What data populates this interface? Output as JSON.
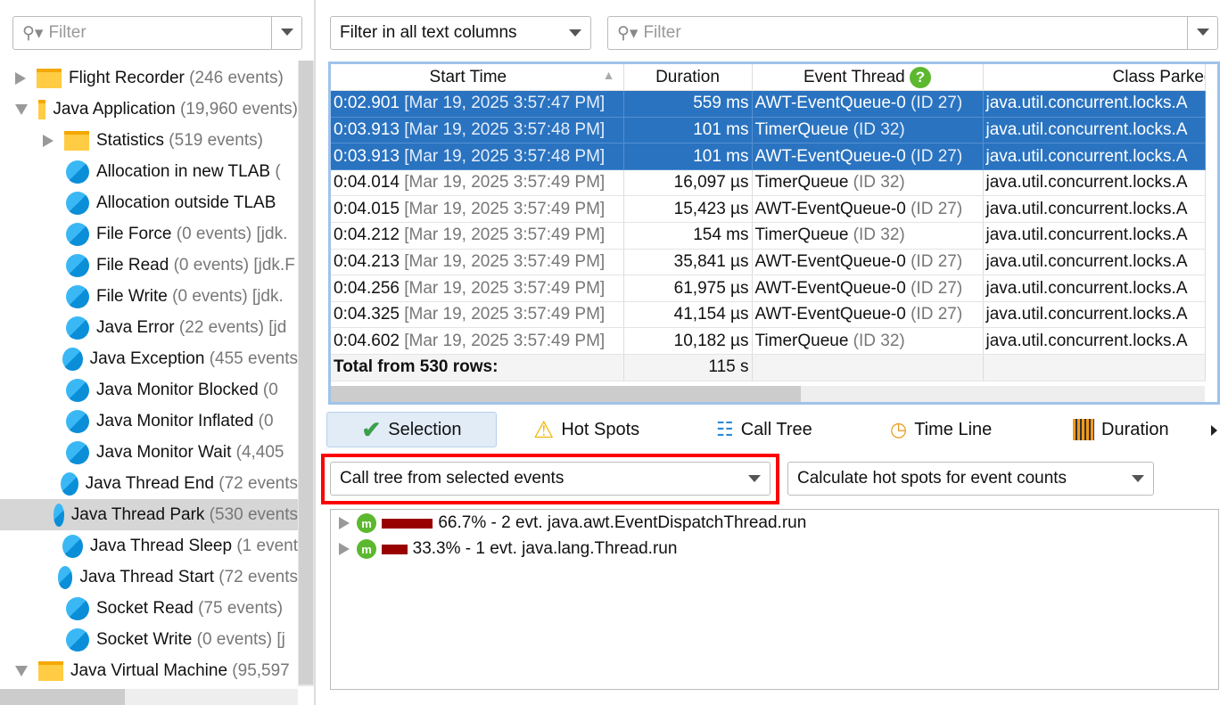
{
  "sidebar": {
    "filter_placeholder": "Filter",
    "items": [
      {
        "label": "Flight Recorder",
        "extra": " (246 events)",
        "type": "folder",
        "state": "collapsed",
        "indent": 0
      },
      {
        "label": "Java Application",
        "extra": " (19,960 events)",
        "type": "folder",
        "state": "expanded",
        "indent": 0
      },
      {
        "label": "Statistics",
        "extra": " (519 events)",
        "type": "folder",
        "state": "collapsed",
        "indent": 1
      },
      {
        "label": "Allocation in new TLAB",
        "extra": " (",
        "type": "event",
        "indent": 1
      },
      {
        "label": "Allocation outside TLAB",
        "extra": "",
        "type": "event",
        "indent": 1
      },
      {
        "label": "File Force",
        "extra": " (0 events) [jdk.",
        "type": "event",
        "indent": 1
      },
      {
        "label": "File Read",
        "extra": " (0 events) [jdk.F",
        "type": "event",
        "indent": 1
      },
      {
        "label": "File Write",
        "extra": " (0 events) [jdk.",
        "type": "event",
        "indent": 1
      },
      {
        "label": "Java Error",
        "extra": " (22 events) [jd",
        "type": "event",
        "indent": 1
      },
      {
        "label": "Java Exception",
        "extra": " (455 events",
        "type": "event",
        "indent": 1
      },
      {
        "label": "Java Monitor Blocked",
        "extra": " (0",
        "type": "event",
        "indent": 1
      },
      {
        "label": "Java Monitor Inflated",
        "extra": " (0",
        "type": "event",
        "indent": 1
      },
      {
        "label": "Java Monitor Wait",
        "extra": " (4,405",
        "type": "event",
        "indent": 1
      },
      {
        "label": "Java Thread End",
        "extra": " (72 events",
        "type": "event",
        "indent": 1
      },
      {
        "label": "Java Thread Park",
        "extra": " (530 events",
        "type": "event",
        "indent": 1,
        "selected": true
      },
      {
        "label": "Java Thread Sleep",
        "extra": " (1 event",
        "type": "event",
        "indent": 1
      },
      {
        "label": "Java Thread Start",
        "extra": " (72 events",
        "type": "event",
        "indent": 1
      },
      {
        "label": "Socket Read",
        "extra": " (75 events)",
        "type": "event",
        "indent": 1
      },
      {
        "label": "Socket Write",
        "extra": " (0 events) [j",
        "type": "event",
        "indent": 1
      },
      {
        "label": "Java Virtual Machine",
        "extra": " (95,597",
        "type": "folder",
        "state": "expanded",
        "indent": 0
      }
    ]
  },
  "toolbar": {
    "filter_mode": "Filter in all text columns",
    "filter_placeholder": "Filter"
  },
  "table": {
    "columns": [
      "Start Time",
      "Duration",
      "Event Thread",
      "Class Parked"
    ],
    "rows": [
      {
        "t": "0:02.901",
        "d": " [Mar 19, 2025 3:57:47 PM]",
        "dur": "559 ms",
        "th": "AWT-EventQueue-0",
        "id": " (ID 27)",
        "cls": "java.util.concurrent.locks.A",
        "sel": true
      },
      {
        "t": "0:03.913",
        "d": " [Mar 19, 2025 3:57:48 PM]",
        "dur": "101 ms",
        "th": "TimerQueue",
        "id": " (ID 32)",
        "cls": "java.util.concurrent.locks.A",
        "sel": true
      },
      {
        "t": "0:03.913",
        "d": " [Mar 19, 2025 3:57:48 PM]",
        "dur": "101 ms",
        "th": "AWT-EventQueue-0",
        "id": " (ID 27)",
        "cls": "java.util.concurrent.locks.A",
        "sel": true
      },
      {
        "t": "0:04.014",
        "d": " [Mar 19, 2025 3:57:49 PM]",
        "dur": "16,097 µs",
        "th": "TimerQueue",
        "id": " (ID 32)",
        "cls": "java.util.concurrent.locks.A"
      },
      {
        "t": "0:04.015",
        "d": " [Mar 19, 2025 3:57:49 PM]",
        "dur": "15,423 µs",
        "th": "AWT-EventQueue-0",
        "id": " (ID 27)",
        "cls": "java.util.concurrent.locks.A"
      },
      {
        "t": "0:04.212",
        "d": " [Mar 19, 2025 3:57:49 PM]",
        "dur": "154 ms",
        "th": "TimerQueue",
        "id": " (ID 32)",
        "cls": "java.util.concurrent.locks.A"
      },
      {
        "t": "0:04.213",
        "d": " [Mar 19, 2025 3:57:49 PM]",
        "dur": "35,841 µs",
        "th": "AWT-EventQueue-0",
        "id": " (ID 27)",
        "cls": "java.util.concurrent.locks.A"
      },
      {
        "t": "0:04.256",
        "d": " [Mar 19, 2025 3:57:49 PM]",
        "dur": "61,975 µs",
        "th": "AWT-EventQueue-0",
        "id": " (ID 27)",
        "cls": "java.util.concurrent.locks.A"
      },
      {
        "t": "0:04.325",
        "d": " [Mar 19, 2025 3:57:49 PM]",
        "dur": "41,154 µs",
        "th": "AWT-EventQueue-0",
        "id": " (ID 27)",
        "cls": "java.util.concurrent.locks.A"
      },
      {
        "t": "0:04.602",
        "d": " [Mar 19, 2025 3:57:49 PM]",
        "dur": "10,182 µs",
        "th": "TimerQueue",
        "id": " (ID 32)",
        "cls": "java.util.concurrent.locks.A"
      }
    ],
    "total_label": "Total from 530 rows:",
    "total_value": "115 s"
  },
  "tabs": [
    {
      "label": "Selection",
      "icon": "check-icon",
      "active": true
    },
    {
      "label": "Hot Spots",
      "icon": "warning-icon"
    },
    {
      "label": "Call Tree",
      "icon": "call-tree-icon"
    },
    {
      "label": "Time Line",
      "icon": "time-line-icon"
    },
    {
      "label": "Duration",
      "icon": "duration-icon"
    }
  ],
  "options": {
    "tree_mode": "Call tree from selected events",
    "hotspot_mode": "Calculate hot spots for event counts"
  },
  "call_tree": [
    {
      "pct": 66.7,
      "text": "66.7% - 2 evt. java.awt.EventDispatchThread.run"
    },
    {
      "pct": 33.3,
      "text": "33.3% - 1 evt. java.lang.Thread.run"
    }
  ],
  "colors": {
    "selection": "#2a73c0",
    "highlight": "#ff0000",
    "bar": "#990000"
  }
}
